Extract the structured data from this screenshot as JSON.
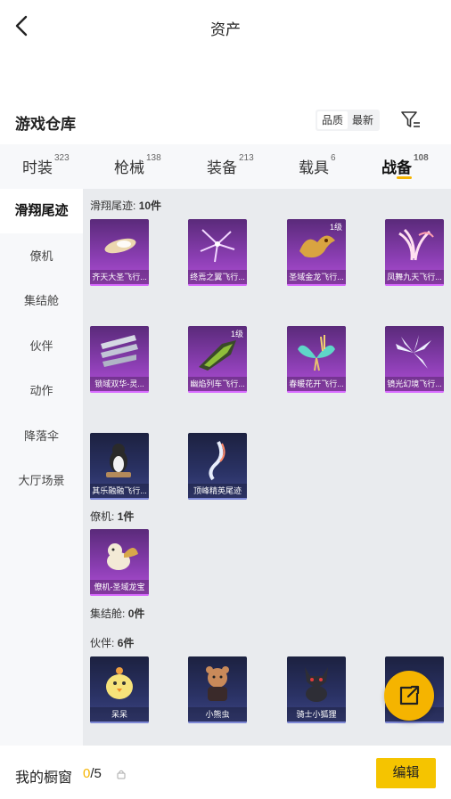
{
  "header": {
    "title": "资产"
  },
  "section": {
    "title": "游戏仓库",
    "sort_options": [
      "品质",
      "最新"
    ],
    "active_sort": "品质"
  },
  "tabs": [
    {
      "label": "时装",
      "count": "323"
    },
    {
      "label": "枪械",
      "count": "138"
    },
    {
      "label": "装备",
      "count": "213"
    },
    {
      "label": "载具",
      "count": "6"
    },
    {
      "label": "战备",
      "count": "108",
      "active": true
    }
  ],
  "sidebar": {
    "items": [
      {
        "label": "滑翔尾迹",
        "active": true
      },
      {
        "label": "僚机"
      },
      {
        "label": "集结舱"
      },
      {
        "label": "伙伴"
      },
      {
        "label": "动作"
      },
      {
        "label": "降落伞"
      },
      {
        "label": "大厅场景"
      }
    ]
  },
  "groups": {
    "trails": {
      "name": "滑翔尾迹",
      "count": "10件"
    },
    "wingman": {
      "name": "僚机",
      "count": "1件"
    },
    "rally": {
      "name": "集结舱",
      "count": "0件"
    },
    "partner": {
      "name": "伙伴",
      "count": "6件"
    }
  },
  "items": [
    {
      "name": "齐天大圣飞行...",
      "level": "",
      "rarity": "purple"
    },
    {
      "name": "终焉之翼飞行...",
      "level": "",
      "rarity": "purple"
    },
    {
      "name": "圣域金龙飞行...",
      "level": "1级",
      "rarity": "purple"
    },
    {
      "name": "凤舞九天飞行...",
      "level": "",
      "rarity": "purple"
    },
    {
      "name": "锁域双华-灵...",
      "level": "",
      "rarity": "purple"
    },
    {
      "name": "幽焰列车飞行...",
      "level": "1级",
      "rarity": "purple"
    },
    {
      "name": "春暖花开飞行...",
      "level": "",
      "rarity": "purple"
    },
    {
      "name": "镜光幻境飞行...",
      "level": "",
      "rarity": "purple"
    },
    {
      "name": "其乐融融飞行...",
      "level": "",
      "rarity": "blue"
    },
    {
      "name": "顶峰精英尾迹",
      "level": "",
      "rarity": "blue"
    },
    {
      "name": "僚机-圣域龙宝",
      "level": "",
      "rarity": "purple"
    },
    {
      "name": "呆呆",
      "level": "",
      "rarity": "blue"
    },
    {
      "name": "小熊虫",
      "level": "",
      "rarity": "blue"
    },
    {
      "name": "骑士小狐狸",
      "level": "",
      "rarity": "blue"
    },
    {
      "name": "",
      "level": "",
      "rarity": "blue"
    }
  ],
  "footer": {
    "label": "我的橱窗",
    "current": "0",
    "total": "/5",
    "edit_label": "编辑"
  },
  "colors": {
    "accent": "#f5b400",
    "purple_rarity": "#8d3fb5",
    "blue_rarity": "#2b3366",
    "content_bg": "#e9ebee"
  }
}
